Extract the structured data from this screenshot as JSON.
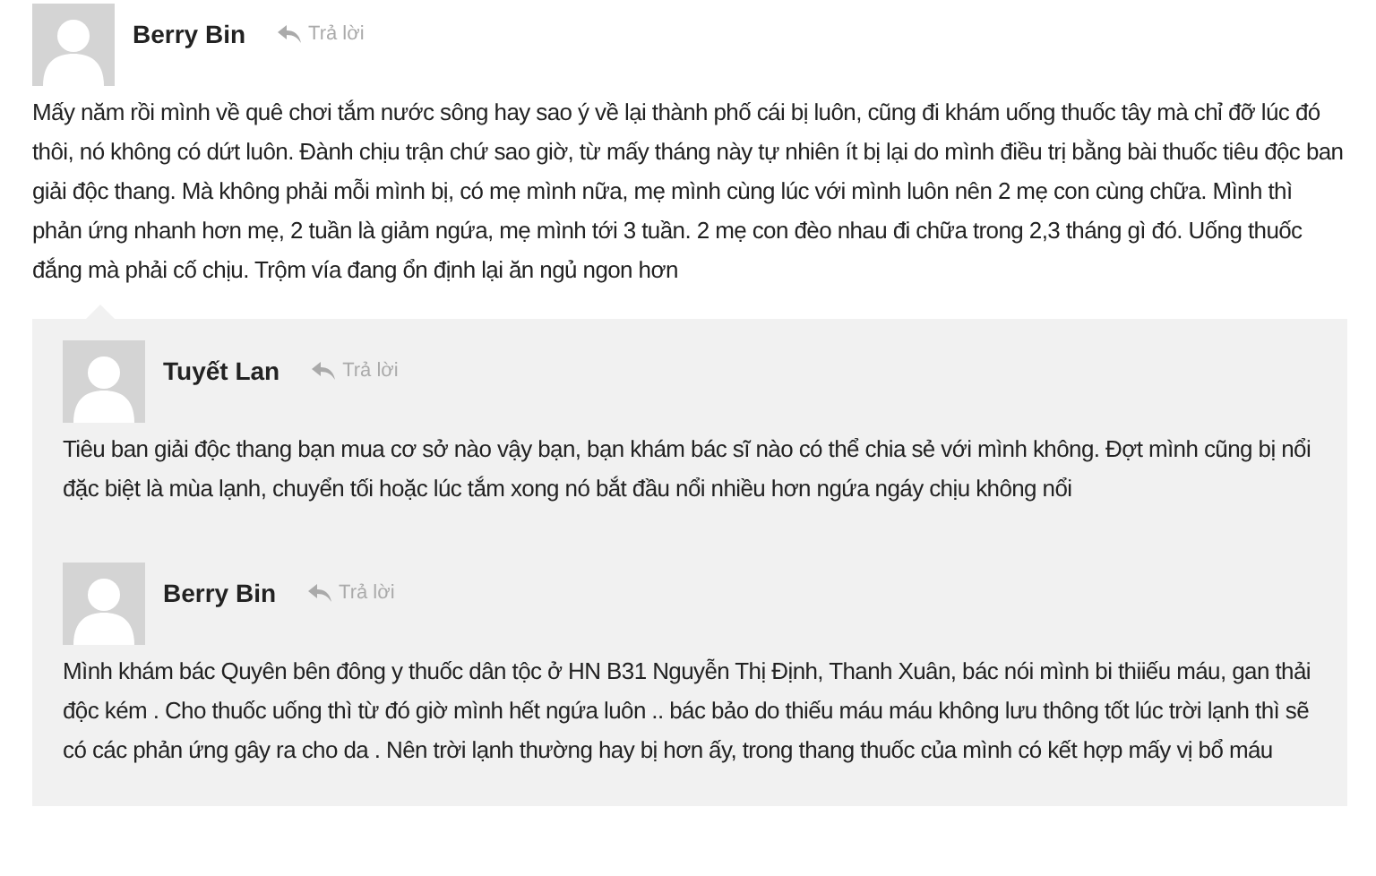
{
  "comment": {
    "author": "Berry Bin",
    "reply_label": "Trả lời",
    "text": "Mấy năm rồi mình về quê chơi tắm nước sông hay sao ý về lại thành phố cái bị luôn, cũng đi khám uống thuốc tây mà chỉ đỡ lúc đó thôi, nó không có dứt luôn. Đành chịu trận chứ sao giờ, từ mấy tháng này tự nhiên ít bị lại do mình điều trị bằng bài thuốc tiêu độc ban giải độc thang. Mà không phải mỗi mình bị, có mẹ mình nữa, mẹ mình cùng lúc với mình luôn nên 2 mẹ con cùng chữa. Mình thì phản ứng nhanh hơn mẹ, 2 tuần là giảm ngứa, mẹ mình tới 3 tuần. 2 mẹ con đèo nhau đi chữa trong 2,3 tháng gì đó. Uống thuốc đắng mà phải cố chịu. Trộm vía đang ổn định lại ăn ngủ ngon hơn"
  },
  "replies": [
    {
      "author": "Tuyết Lan",
      "reply_label": "Trả lời",
      "text": "Tiêu ban giải độc thang bạn mua cơ sở nào vậy bạn, bạn khám bác sĩ nào có thể chia sẻ với mình không. Đợt mình cũng bị nổi đặc biệt là mùa lạnh, chuyển tối hoặc lúc tắm xong nó bắt đầu nổi nhiều hơn ngứa ngáy chịu không nổi"
    },
    {
      "author": "Berry Bin",
      "reply_label": "Trả lời",
      "text": "Mình khám bác Quyên bên đông y thuốc dân tộc ở HN B31 Nguyễn Thị Định, Thanh Xuân, bác nói mình bi thiiếu máu, gan thải độc kém . Cho thuốc uống thì từ đó giờ mình hết ngứa luôn .. bác bảo do thiếu máu máu không lưu thông tốt lúc trời lạnh thì sẽ có các phản ứng gây ra cho da . Nên trời lạnh thường hay bị hơn ấy, trong thang thuốc của mình có kết hợp mấy vị bổ máu"
    }
  ]
}
